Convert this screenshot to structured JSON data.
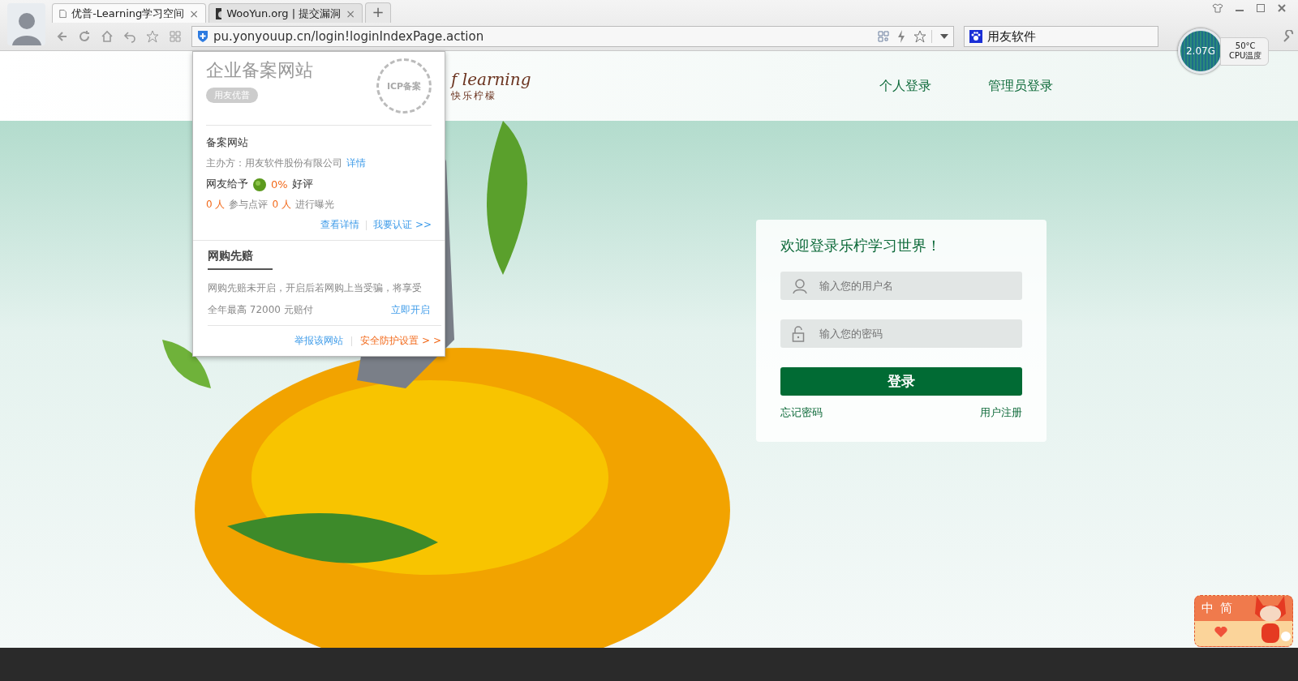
{
  "browser": {
    "tabs": [
      {
        "title": "优普-Learning学习空间",
        "selected": true,
        "close": "×"
      },
      {
        "title": "WooYun.org | 提交漏洞",
        "selected": false,
        "close": "×"
      }
    ],
    "new_tab": "+",
    "address": "pu.yonyouup.cn/login!loginIndexPage.action",
    "search_engine": "用友软件",
    "cpu_widget": {
      "value": "2.07G",
      "temperature": "50°C",
      "label": "CPU温度"
    }
  },
  "site_popup": {
    "title": "企业备案网站",
    "badge": "用友优普",
    "seal": "ICP备案",
    "section_title": "备案网站",
    "sponsor": "主办方：用友软件股份有限公司",
    "sponsor_link": "详情",
    "rating_label": "网友给予",
    "rating_value": "0%",
    "rating_suffix": "好评",
    "stats": [
      {
        "count": "0 人",
        "text": "参与点评"
      },
      {
        "count": "0 人",
        "text": "进行曝光"
      }
    ],
    "links": [
      "查看详情",
      "我要认证 >>"
    ],
    "compensation": {
      "title": "网购先赔",
      "lines": [
        "网购先赔未开启，开启后若网购上当受骗，将享受",
        "全年最高 72000 元赔付"
      ],
      "link": "立即开启"
    },
    "footer_links": [
      {
        "label": "举报该网站",
        "kind": "report"
      },
      {
        "label": "安全防护设置 > >",
        "kind": "settings"
      }
    ]
  },
  "header": {
    "logo": "f learning",
    "logo_sub": "快乐柠檬",
    "nav": [
      "个人登录",
      "管理员登录"
    ]
  },
  "login": {
    "title": "欢迎登录乐柠学习世界！",
    "username_placeholder": "输入您的用户名",
    "password_placeholder": "输入您的密码",
    "submit": "登录",
    "forgot": "忘记密码",
    "register": "用户注册"
  },
  "ime": {
    "keys": [
      "中",
      "简"
    ]
  }
}
